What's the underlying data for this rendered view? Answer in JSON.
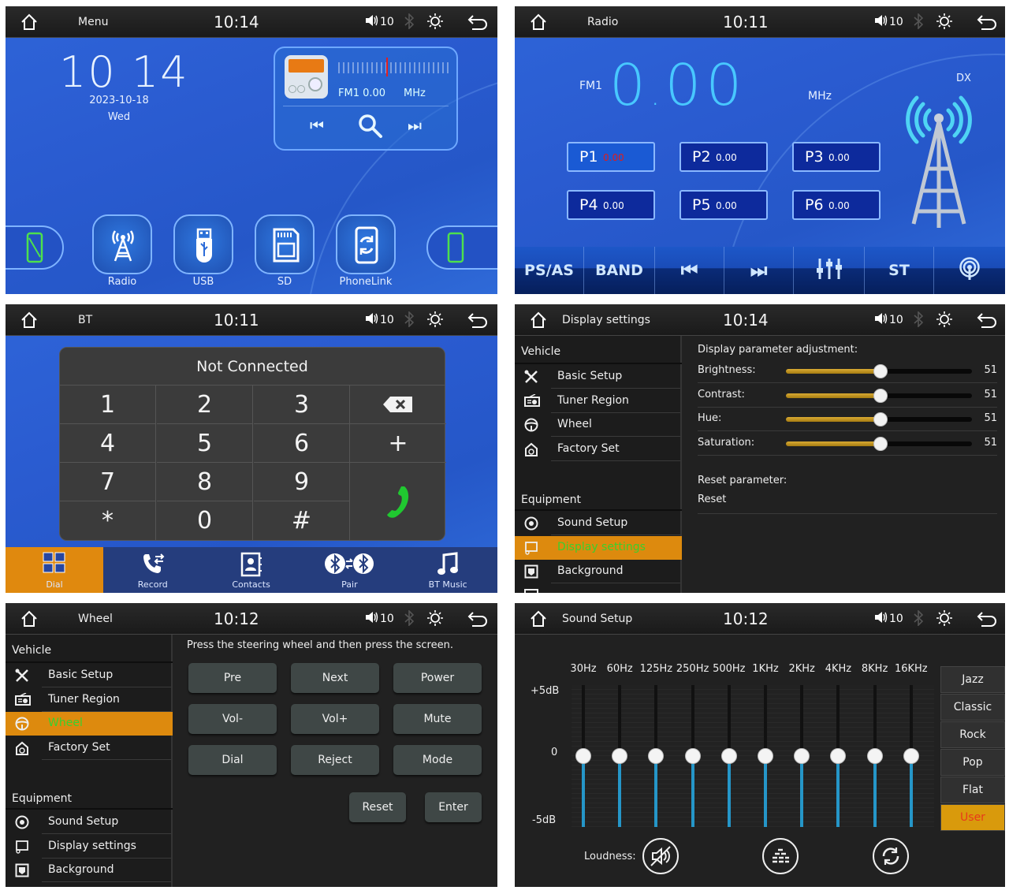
{
  "status_common": {
    "volume": "10",
    "volume_icon": "speaker-icon",
    "bluetooth_icon": "bluetooth-icon",
    "brightness_icon": "sun-icon",
    "back_icon": "back-arrow-icon",
    "home_icon": "home-icon"
  },
  "menu": {
    "title": "Menu",
    "clock": "10:14",
    "big_clock": "10 14",
    "date": "2023-10-18",
    "weekday": "Wed",
    "radio_widget": {
      "band_freq": "FM1 0.00",
      "unit": "MHz",
      "prev_icon": "prev-track-icon",
      "search_icon": "search-icon",
      "next_icon": "next-track-icon"
    },
    "apps": [
      {
        "label": "Radio",
        "icon": "radio-tower-icon"
      },
      {
        "label": "USB",
        "icon": "usb-icon"
      },
      {
        "label": "SD",
        "icon": "sd-card-icon"
      },
      {
        "label": "PhoneLink",
        "icon": "phonelink-icon"
      }
    ]
  },
  "radio": {
    "title": "Radio",
    "clock": "10:11",
    "band": "FM1",
    "frequency_int": "0",
    "frequency_sep": ".",
    "frequency_dec": "00",
    "unit": "MHz",
    "dx": "DX",
    "selected_preset": "P1",
    "presets": [
      {
        "name": "P1",
        "value": "0.00"
      },
      {
        "name": "P2",
        "value": "0.00"
      },
      {
        "name": "P3",
        "value": "0.00"
      },
      {
        "name": "P4",
        "value": "0.00"
      },
      {
        "name": "P5",
        "value": "0.00"
      },
      {
        "name": "P6",
        "value": "0.00"
      }
    ],
    "toolbar": [
      {
        "label": "PS/AS"
      },
      {
        "label": "BAND"
      },
      {
        "label": "⏮",
        "icon": "prev-track-icon"
      },
      {
        "label": "⏭",
        "icon": "next-track-icon"
      },
      {
        "label": "",
        "icon": "equalizer-icon"
      },
      {
        "label": "ST"
      },
      {
        "label": "",
        "icon": "broadcast-icon"
      }
    ]
  },
  "bt": {
    "title": "BT",
    "clock": "10:11",
    "status": "Not Connected",
    "keys": [
      "1",
      "2",
      "3",
      "4",
      "5",
      "6",
      "7",
      "8",
      "9",
      "*",
      "0",
      "#"
    ],
    "side_keys": {
      "backspace_icon": "backspace-icon",
      "plus": "+",
      "call_icon": "phone-call-icon"
    },
    "tabs": [
      {
        "label": "Dial",
        "icon": "dialpad-icon",
        "active": true
      },
      {
        "label": "Record",
        "icon": "call-log-icon"
      },
      {
        "label": "Contacts",
        "icon": "contacts-icon"
      },
      {
        "label": "Pair",
        "icon": "bluetooth-pair-icon"
      },
      {
        "label": "BT Music",
        "icon": "music-note-icon"
      }
    ]
  },
  "display": {
    "title": "Display settings",
    "clock": "10:14",
    "sidebar": {
      "vehicle_label": "Vehicle",
      "vehicle_items": [
        {
          "label": "Basic Setup",
          "icon": "tools-icon"
        },
        {
          "label": "Tuner Region",
          "icon": "radio-icon"
        },
        {
          "label": "Wheel",
          "icon": "steering-wheel-icon"
        },
        {
          "label": "Factory Set",
          "icon": "factory-icon"
        }
      ],
      "equipment_label": "Equipment",
      "equipment_items": [
        {
          "label": "Sound Setup",
          "icon": "speaker-icon"
        },
        {
          "label": "Display settings",
          "icon": "display-icon",
          "active": true
        },
        {
          "label": "Background",
          "icon": "background-icon"
        }
      ]
    },
    "heading": "Display parameter adjustment:",
    "params": [
      {
        "label": "Brightness:",
        "value": 51,
        "max": 100
      },
      {
        "label": "Contrast:",
        "value": 51,
        "max": 100
      },
      {
        "label": "Hue:",
        "value": 51,
        "max": 100
      },
      {
        "label": "Saturation:",
        "value": 51,
        "max": 100
      }
    ],
    "reset_label": "Reset parameter:",
    "reset_button": "Reset"
  },
  "wheel": {
    "title": "Wheel",
    "clock": "10:12",
    "sidebar": {
      "vehicle_label": "Vehicle",
      "vehicle_items": [
        {
          "label": "Basic Setup",
          "icon": "tools-icon"
        },
        {
          "label": "Tuner Region",
          "icon": "radio-icon"
        },
        {
          "label": "Wheel",
          "icon": "steering-wheel-icon",
          "active": true
        },
        {
          "label": "Factory Set",
          "icon": "factory-icon"
        }
      ],
      "equipment_label": "Equipment",
      "equipment_items": [
        {
          "label": "Sound Setup",
          "icon": "speaker-icon"
        },
        {
          "label": "Display settings",
          "icon": "display-icon"
        },
        {
          "label": "Background",
          "icon": "background-icon"
        }
      ]
    },
    "hint": "Press the steering wheel and then press the screen.",
    "buttons": [
      "Pre",
      "Next",
      "Power",
      "Vol-",
      "Vol+",
      "Mute",
      "Dial",
      "Reject",
      "Mode"
    ],
    "reset": "Reset",
    "enter": "Enter"
  },
  "sound": {
    "title": "Sound Setup",
    "clock": "10:12",
    "db_top": "+5dB",
    "db_mid": "0",
    "db_bottom": "-5dB",
    "bands": [
      {
        "freq": "30Hz",
        "gain_db": 0
      },
      {
        "freq": "60Hz",
        "gain_db": 0
      },
      {
        "freq": "125Hz",
        "gain_db": 0
      },
      {
        "freq": "250Hz",
        "gain_db": 0
      },
      {
        "freq": "500Hz",
        "gain_db": 0
      },
      {
        "freq": "1KHz",
        "gain_db": 0
      },
      {
        "freq": "2KHz",
        "gain_db": 0
      },
      {
        "freq": "4KHz",
        "gain_db": 0
      },
      {
        "freq": "8KHz",
        "gain_db": 0
      },
      {
        "freq": "16KHz",
        "gain_db": 0
      }
    ],
    "presets": [
      {
        "label": "Jazz"
      },
      {
        "label": "Classic"
      },
      {
        "label": "Rock"
      },
      {
        "label": "Pop"
      },
      {
        "label": "Flat"
      },
      {
        "label": "User",
        "active": true
      }
    ],
    "loudness_label": "Loudness:",
    "loudness_icon": "loudness-off-icon",
    "eq_icon": "eq-bars-icon",
    "reset_icon": "refresh-icon"
  },
  "colors": {
    "accent_orange": "#dd8a0e",
    "active_text_green": "#39d02e",
    "freq_blue": "#48c8ff",
    "eq_fill": "#2596c8"
  }
}
